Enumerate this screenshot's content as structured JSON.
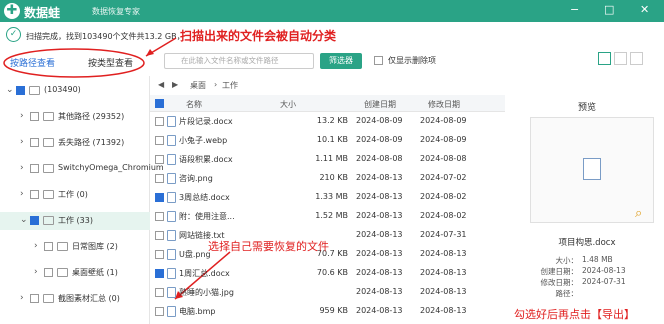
{
  "app": {
    "name": "数据蛙",
    "subtitle": "数据恢复专家",
    "window_controls": [
      "−",
      "□",
      "✕"
    ]
  },
  "status": {
    "text": "扫描完成，找到103490个文件共13.2 GB，"
  },
  "annotations": {
    "scan_note": "扫描出来的文件会被自动分类",
    "select_note": "选择自己需要恢复的文件",
    "export_note": "勾选好后再点击【导出】"
  },
  "tabs": [
    {
      "label": "按路径查看",
      "active": true
    },
    {
      "label": "按类型查看",
      "active": false
    }
  ],
  "toolbar": {
    "search_placeholder": "在此输入文件名称或文件路径",
    "filter_label": "筛选器",
    "only_deleted_label": "仅显示删除项"
  },
  "tree": [
    {
      "label": "(103490)",
      "level": 0,
      "expanded": true,
      "checkbox": "partial",
      "selected": false
    },
    {
      "label": "其他路径 (29352)",
      "level": 1,
      "expanded": false,
      "checkbox": "off",
      "selected": false
    },
    {
      "label": "丢失路径 (71392)",
      "level": 1,
      "expanded": false,
      "checkbox": "off",
      "selected": false
    },
    {
      "label": "SwitchyOmega_Chromium",
      "level": 1,
      "expanded": false,
      "checkbox": "off",
      "selected": false
    },
    {
      "label": "工作 (0)",
      "level": 1,
      "expanded": false,
      "checkbox": "off",
      "selected": false
    },
    {
      "label": "工作 (33)",
      "level": 1,
      "expanded": true,
      "checkbox": "partial",
      "selected": true
    },
    {
      "label": "日常图库 (2)",
      "level": 2,
      "expanded": false,
      "checkbox": "off",
      "selected": false
    },
    {
      "label": "桌面壁纸 (1)",
      "level": 2,
      "expanded": false,
      "checkbox": "off",
      "selected": false
    },
    {
      "label": "截图素材汇总 (0)",
      "level": 1,
      "expanded": false,
      "checkbox": "off",
      "selected": false
    }
  ],
  "breadcrumb": [
    "桌面",
    "工作"
  ],
  "table": {
    "headers": [
      "名称",
      "大小",
      "创建日期",
      "修改日期"
    ],
    "rows": [
      {
        "name": "片段记录.docx",
        "size": "13.2 KB",
        "created": "2024-08-09",
        "modified": "2024-08-09",
        "checked": false,
        "icon": "word-icon"
      },
      {
        "name": "小兔子.webp",
        "size": "10.1 KB",
        "created": "2024-08-09",
        "modified": "2024-08-09",
        "checked": false,
        "icon": "chrome-icon"
      },
      {
        "name": "语段积累.docx",
        "size": "1.11 MB",
        "created": "2024-08-08",
        "modified": "2024-08-08",
        "checked": false,
        "icon": "word-icon"
      },
      {
        "name": "咨询.png",
        "size": "210 KB",
        "created": "2024-08-13",
        "modified": "2024-07-02",
        "checked": false,
        "icon": "image-icon"
      },
      {
        "name": "3周总结.docx",
        "size": "1.33 MB",
        "created": "2024-08-13",
        "modified": "2024-08-02",
        "checked": true,
        "icon": "word-icon"
      },
      {
        "name": "附：使用注意...",
        "size": "1.52 MB",
        "created": "2024-08-13",
        "modified": "2024-08-02",
        "checked": false,
        "icon": "word-icon"
      },
      {
        "name": "网站链接.txt",
        "size": "",
        "created": "2024-08-13",
        "modified": "2024-07-31",
        "checked": false,
        "icon": "text-icon"
      },
      {
        "name": "U盘.png",
        "size": "70.7 KB",
        "created": "2024-08-13",
        "modified": "2024-08-13",
        "checked": false,
        "icon": "image-icon"
      },
      {
        "name": "1周汇总.docx",
        "size": "70.6 KB",
        "created": "2024-08-13",
        "modified": "2024-08-13",
        "checked": true,
        "icon": "word-icon"
      },
      {
        "name": "熟睡的小猫.jpg",
        "size": "",
        "created": "2024-08-13",
        "modified": "2024-08-13",
        "checked": false,
        "icon": "image-icon"
      },
      {
        "name": "电脑.bmp",
        "size": "959 KB",
        "created": "2024-08-13",
        "modified": "2024-08-13",
        "checked": false,
        "icon": "image-icon"
      }
    ]
  },
  "preview": {
    "title": "预览",
    "filename": "项目构思.docx",
    "details": [
      {
        "label": "大小：",
        "value": "1.48 MB"
      },
      {
        "label": "创建日期：",
        "value": "2024-08-13"
      },
      {
        "label": "修改日期：",
        "value": "2024-07-31"
      },
      {
        "label": "路径：",
        "value": ""
      }
    ]
  },
  "colors": {
    "brand": "#2aa386",
    "annotation": "#e02020",
    "checkbox": "#2a6fd6"
  }
}
